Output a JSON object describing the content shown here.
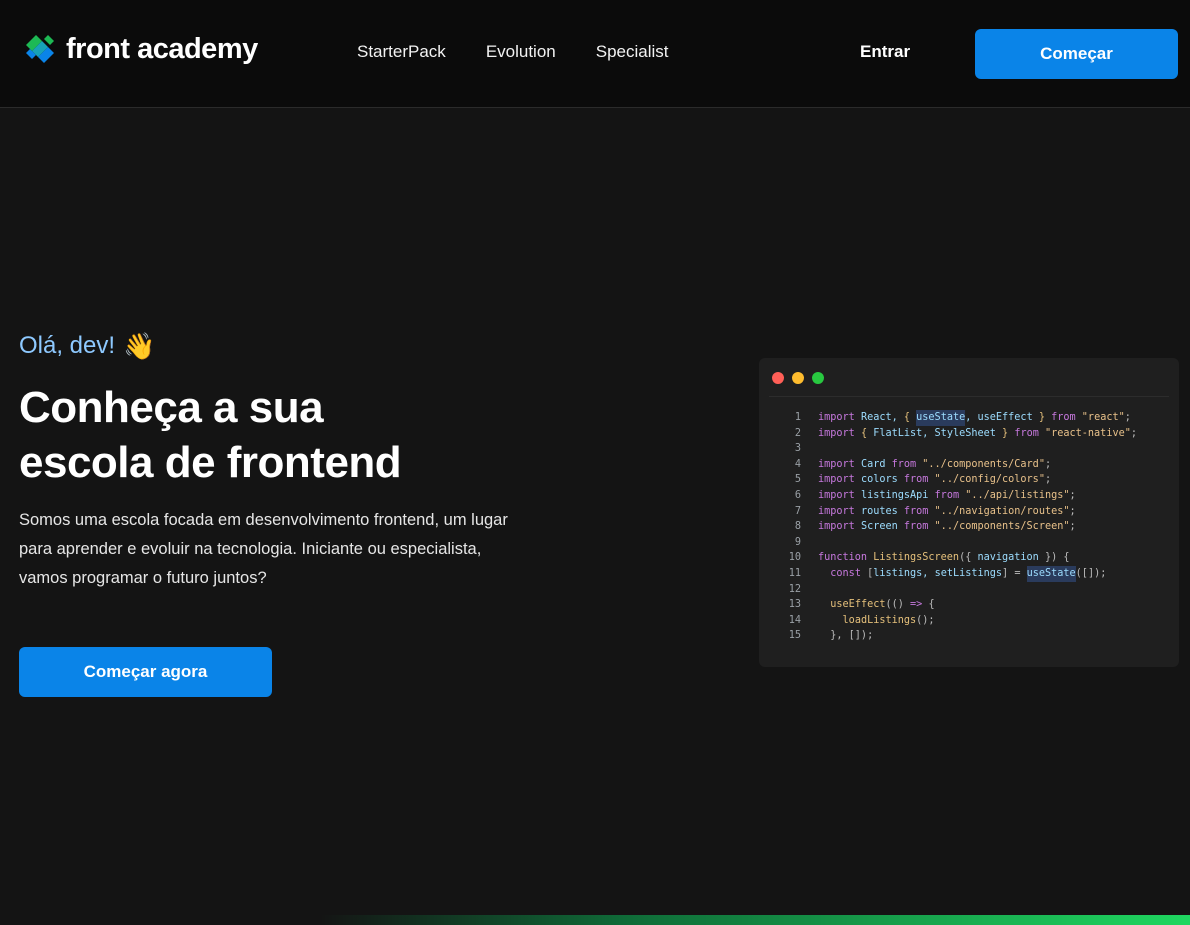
{
  "header": {
    "logo_text": "front academy",
    "nav": [
      {
        "label": "StarterPack"
      },
      {
        "label": "Evolution"
      },
      {
        "label": "Specialist"
      }
    ],
    "login_label": "Entrar",
    "cta_label": "Começar"
  },
  "hero": {
    "greeting": "Olá, dev!",
    "wave_emoji": "👋",
    "headline_line1": "Conheça a sua",
    "headline_line2": "escola de frontend",
    "description": "Somos uma escola focada em desenvolvimento frontend, um lugar para aprender e evoluir na tecnologia. Iniciante ou especialista, vamos programar o futuro juntos?",
    "cta_label": "Começar agora"
  },
  "code_window": {
    "lines": [
      {
        "n": "1",
        "t": [
          [
            "kw",
            "import "
          ],
          [
            "id",
            "React, "
          ],
          [
            "fn",
            "{ "
          ],
          [
            "hl",
            "useState"
          ],
          [
            "id",
            ", useEffect "
          ],
          [
            "fn",
            "} "
          ],
          [
            "kw",
            "from "
          ],
          [
            "str",
            "\"react\""
          ],
          [
            "pn",
            ";"
          ]
        ]
      },
      {
        "n": "2",
        "t": [
          [
            "kw",
            "import "
          ],
          [
            "fn",
            "{ "
          ],
          [
            "id",
            "FlatList, StyleSheet "
          ],
          [
            "fn",
            "} "
          ],
          [
            "kw",
            "from "
          ],
          [
            "str",
            "\"react-native\""
          ],
          [
            "pn",
            ";"
          ]
        ]
      },
      {
        "n": "3",
        "t": []
      },
      {
        "n": "4",
        "t": [
          [
            "kw",
            "import "
          ],
          [
            "id",
            "Card "
          ],
          [
            "kw",
            "from "
          ],
          [
            "str",
            "\"../components/Card\""
          ],
          [
            "pn",
            ";"
          ]
        ]
      },
      {
        "n": "5",
        "t": [
          [
            "kw",
            "import "
          ],
          [
            "id",
            "colors "
          ],
          [
            "kw",
            "from "
          ],
          [
            "str",
            "\"../config/colors\""
          ],
          [
            "pn",
            ";"
          ]
        ]
      },
      {
        "n": "6",
        "t": [
          [
            "kw",
            "import "
          ],
          [
            "id",
            "listingsApi "
          ],
          [
            "kw",
            "from "
          ],
          [
            "str",
            "\"../api/listings\""
          ],
          [
            "pn",
            ";"
          ]
        ]
      },
      {
        "n": "7",
        "t": [
          [
            "kw",
            "import "
          ],
          [
            "id",
            "routes "
          ],
          [
            "kw",
            "from "
          ],
          [
            "str",
            "\"../navigation/routes\""
          ],
          [
            "pn",
            ";"
          ]
        ]
      },
      {
        "n": "8",
        "t": [
          [
            "kw",
            "import "
          ],
          [
            "id",
            "Screen "
          ],
          [
            "kw",
            "from "
          ],
          [
            "str",
            "\"../components/Screen\""
          ],
          [
            "pn",
            ";"
          ]
        ]
      },
      {
        "n": "9",
        "t": []
      },
      {
        "n": "10",
        "t": [
          [
            "kw",
            "function "
          ],
          [
            "fn",
            "ListingsScreen"
          ],
          [
            "pn",
            "({ "
          ],
          [
            "id",
            "navigation "
          ],
          [
            "pn",
            "}) {"
          ]
        ]
      },
      {
        "n": "11",
        "t": [
          [
            "pn",
            "  "
          ],
          [
            "kw",
            "const "
          ],
          [
            "pn",
            "["
          ],
          [
            "id",
            "listings, setListings"
          ],
          [
            "pn",
            "] = "
          ],
          [
            "hl",
            "useState"
          ],
          [
            "pn",
            "([]);"
          ]
        ]
      },
      {
        "n": "12",
        "t": []
      },
      {
        "n": "13",
        "t": [
          [
            "pn",
            "  "
          ],
          [
            "fn",
            "useEffect"
          ],
          [
            "pn",
            "(() "
          ],
          [
            "kw",
            "=> "
          ],
          [
            "pn",
            "{"
          ]
        ]
      },
      {
        "n": "14",
        "t": [
          [
            "pn",
            "    "
          ],
          [
            "fn",
            "loadListings"
          ],
          [
            "pn",
            "();"
          ]
        ]
      },
      {
        "n": "15",
        "t": [
          [
            "pn",
            "  }, []);"
          ]
        ]
      }
    ]
  },
  "colors": {
    "accent": "#0a84e8",
    "greeting": "#8ec9ff",
    "background": "#141414",
    "header_bg": "#0b0b0b",
    "dot_red": "#ff5f57",
    "dot_yellow": "#febc2e",
    "dot_green": "#28c840"
  }
}
